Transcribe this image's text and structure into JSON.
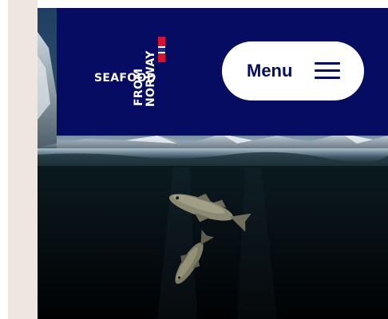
{
  "brand": {
    "logo_line1": "SEAFOOD",
    "logo_line2": "FROM",
    "logo_line3": "NORWAY",
    "colors": {
      "navy": "#060c62",
      "flag_red": "#d8112e",
      "flag_white": "#ffffff",
      "flag_blue": "#1c2a88",
      "side_strip": "#efe6e1"
    }
  },
  "header": {
    "menu_label": "Menu",
    "menu_icon": "hamburger-icon"
  },
  "hero": {
    "image": "underwater-cod-fish-image"
  }
}
